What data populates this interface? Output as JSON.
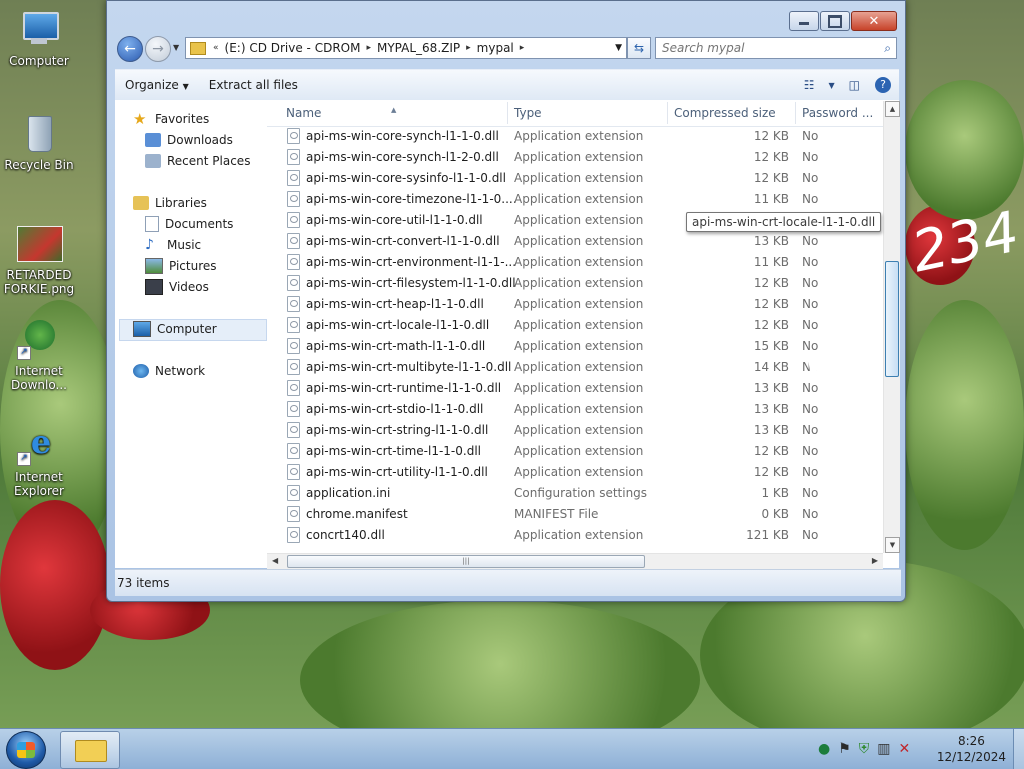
{
  "desktop": {
    "icons": [
      {
        "label": "Computer"
      },
      {
        "label": "Recycle Bin"
      },
      {
        "label": "RETARDED FORKIE.png"
      },
      {
        "label": "Internet Downlo..."
      },
      {
        "label": "Internet Explorer"
      }
    ],
    "wallpaper_text": "234"
  },
  "window": {
    "address": {
      "segments": [
        "(E:) CD Drive - CDROM",
        "MYPAL_68.ZIP",
        "mypal"
      ]
    },
    "search": {
      "placeholder": "Search mypal"
    },
    "toolbar": {
      "organize": "Organize",
      "extract": "Extract all files"
    },
    "nav": {
      "favorites": "Favorites",
      "downloads": "Downloads",
      "recent_places": "Recent Places",
      "libraries": "Libraries",
      "documents": "Documents",
      "music": "Music",
      "pictures": "Pictures",
      "videos": "Videos",
      "computer": "Computer",
      "network": "Network"
    },
    "columns": {
      "name": "Name",
      "type": "Type",
      "compressed_size": "Compressed size",
      "password": "Password ..."
    },
    "files": [
      {
        "name": "api-ms-win-core-synch-l1-1-0.dll",
        "type": "Application extension",
        "size": "12 KB",
        "password": "No"
      },
      {
        "name": "api-ms-win-core-synch-l1-2-0.dll",
        "type": "Application extension",
        "size": "12 KB",
        "password": "No"
      },
      {
        "name": "api-ms-win-core-sysinfo-l1-1-0.dll",
        "type": "Application extension",
        "size": "12 KB",
        "password": "No"
      },
      {
        "name": "api-ms-win-core-timezone-l1-1-0....",
        "type": "Application extension",
        "size": "11 KB",
        "password": "No"
      },
      {
        "name": "api-ms-win-core-util-l1-1-0.dll",
        "type": "Application extension",
        "size": "",
        "password": ""
      },
      {
        "name": "api-ms-win-crt-convert-l1-1-0.dll",
        "type": "Application extension",
        "size": "13 KB",
        "password": "No"
      },
      {
        "name": "api-ms-win-crt-environment-l1-1-...",
        "type": "Application extension",
        "size": "11 KB",
        "password": "No"
      },
      {
        "name": "api-ms-win-crt-filesystem-l1-1-0.dll",
        "type": "Application extension",
        "size": "12 KB",
        "password": "No"
      },
      {
        "name": "api-ms-win-crt-heap-l1-1-0.dll",
        "type": "Application extension",
        "size": "12 KB",
        "password": "No"
      },
      {
        "name": "api-ms-win-crt-locale-l1-1-0.dll",
        "type": "Application extension",
        "size": "12 KB",
        "password": "No"
      },
      {
        "name": "api-ms-win-crt-math-l1-1-0.dll",
        "type": "Application extension",
        "size": "15 KB",
        "password": "No"
      },
      {
        "name": "api-ms-win-crt-multibyte-l1-1-0.dll",
        "type": "Application extension",
        "size": "14 KB",
        "password": "No"
      },
      {
        "name": "api-ms-win-crt-runtime-l1-1-0.dll",
        "type": "Application extension",
        "size": "13 KB",
        "password": "No"
      },
      {
        "name": "api-ms-win-crt-stdio-l1-1-0.dll",
        "type": "Application extension",
        "size": "13 KB",
        "password": "No"
      },
      {
        "name": "api-ms-win-crt-string-l1-1-0.dll",
        "type": "Application extension",
        "size": "13 KB",
        "password": "No"
      },
      {
        "name": "api-ms-win-crt-time-l1-1-0.dll",
        "type": "Application extension",
        "size": "12 KB",
        "password": "No"
      },
      {
        "name": "api-ms-win-crt-utility-l1-1-0.dll",
        "type": "Application extension",
        "size": "12 KB",
        "password": "No"
      },
      {
        "name": "application.ini",
        "type": "Configuration settings",
        "size": "1 KB",
        "password": "No"
      },
      {
        "name": "chrome.manifest",
        "type": "MANIFEST File",
        "size": "0 KB",
        "password": "No"
      },
      {
        "name": "concrt140.dll",
        "type": "Application extension",
        "size": "121 KB",
        "password": "No"
      }
    ],
    "tooltip": "api-ms-win-crt-locale-l1-1-0.dll",
    "status": {
      "item_count": "73 items"
    }
  },
  "taskbar": {
    "time": "8:26",
    "date": "12/12/2024"
  }
}
